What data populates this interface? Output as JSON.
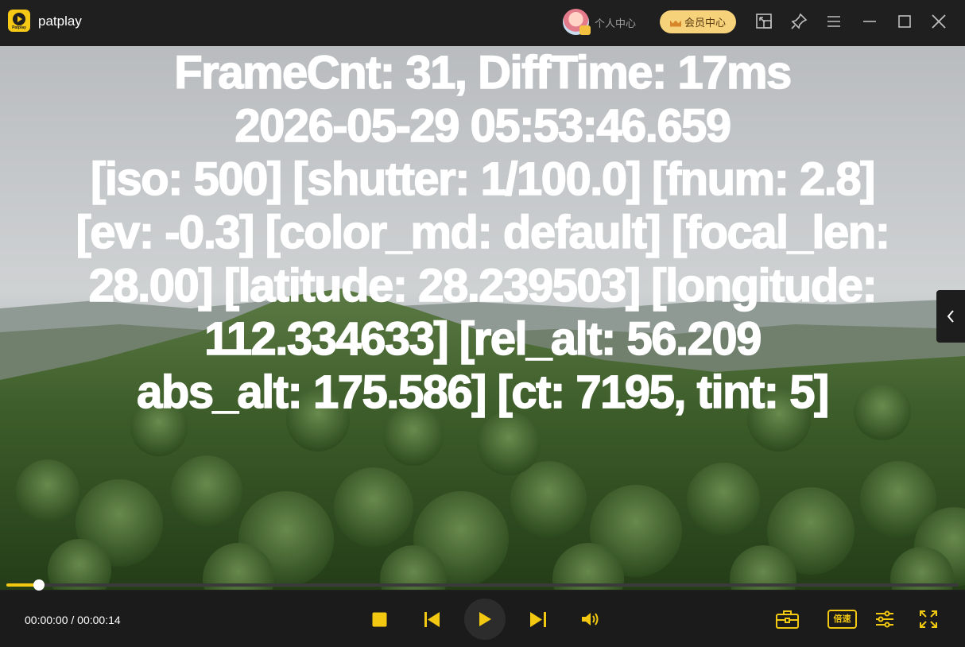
{
  "app": {
    "name": "patplay",
    "logo_text": "Patplay"
  },
  "titlebar": {
    "personal_center": "个人中心",
    "vip_center": "会员中心",
    "icons": [
      "mini-player-icon",
      "pin-icon",
      "menu-icon",
      "minimize-icon",
      "maximize-icon",
      "close-icon"
    ]
  },
  "video": {
    "overlay_lines": [
      "FrameCnt: 31, DiffTime: 17ms",
      "2026-05-29 05:53:46.659",
      "[iso: 500] [shutter: 1/100.0] [fnum: 2.8]",
      "[ev: -0.3] [color_md: default] [focal_len:",
      "28.00] [latitude: 28.239503] [longitude:",
      "112.334633] [rel_alt: 56.209",
      "abs_alt: 175.586] [ct: 7195, tint: 5]"
    ]
  },
  "playback": {
    "time": "00:00:00 / 00:00:14",
    "progress_fraction": 0.034
  },
  "controls": {
    "speed_label": "倍速",
    "accent_color": "#f2c811",
    "icons": [
      "stop-icon",
      "previous-icon",
      "play-icon",
      "next-icon",
      "volume-icon",
      "toolbox-icon",
      "equalizer-icon",
      "fullscreen-icon"
    ]
  }
}
